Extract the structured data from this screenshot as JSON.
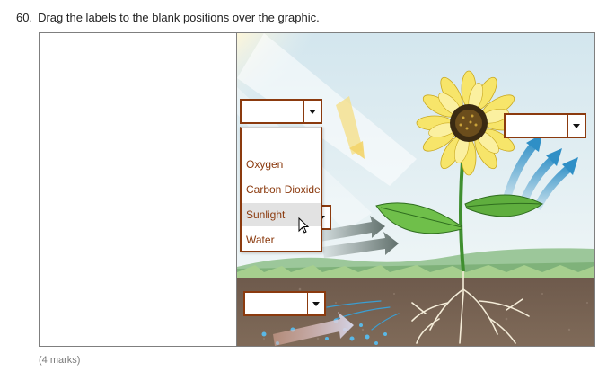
{
  "question": {
    "number": "60.",
    "text": "Drag the labels to the blank positions over the graphic."
  },
  "dropdown_menu": {
    "options": [
      "Oxygen",
      "Carbon Dioxide",
      "Sunlight",
      "Water"
    ],
    "highlighted": "Sunlight"
  },
  "marks": "(4 marks)",
  "colors": {
    "dropbox_border": "#8b3a0e",
    "option_text": "#8b3a0e",
    "highlight_bg": "#e2e2e2"
  }
}
